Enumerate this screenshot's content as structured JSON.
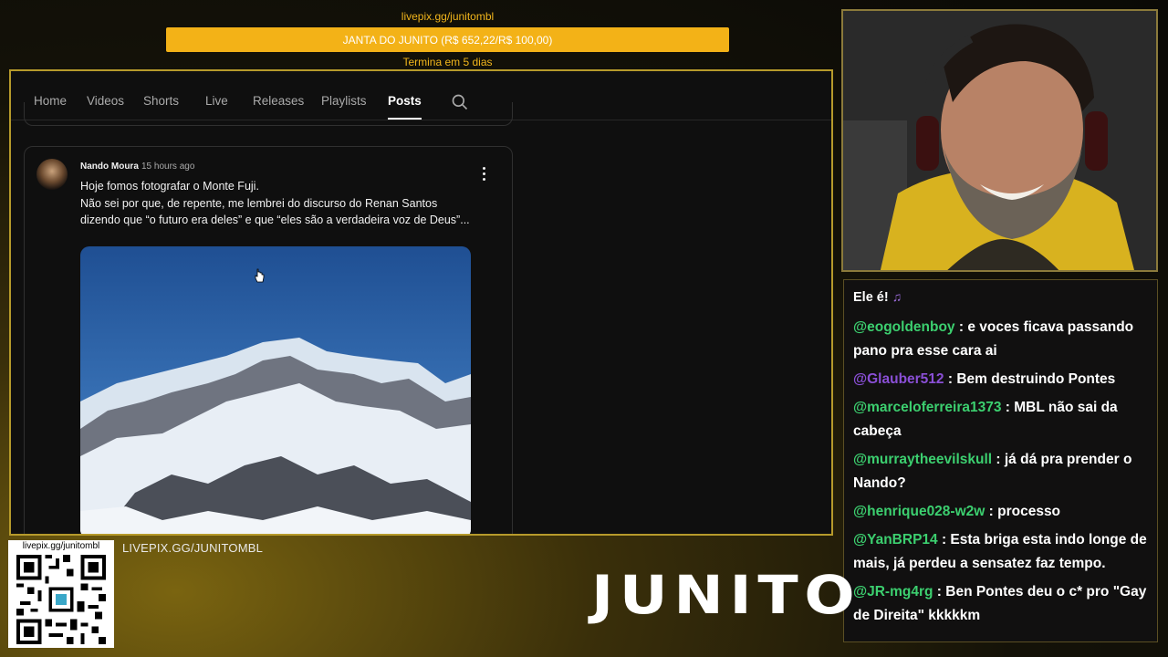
{
  "goal": {
    "url": "livepix.gg/junitombl",
    "label": "JANTA DO JUNITO (R$ 652,22/R$ 100,00)",
    "subtitle": "Termina em 5 dias",
    "color": "#f3b217"
  },
  "youtube": {
    "tabs": [
      "Home",
      "Videos",
      "Shorts",
      "Live",
      "Releases",
      "Playlists",
      "Posts"
    ],
    "active_tab": "Posts",
    "post": {
      "author": "Nando Moura",
      "time": "15 hours ago",
      "text": "Hoje fomos fotografar o Monte Fuji.\nNão sei por que, de repente, me lembrei do discurso do Renan Santos dizendo que “o futuro era deles” e que “eles são a verdadeira voz de Deus”..."
    }
  },
  "chat": {
    "header": "Ele é!",
    "header_icon": "music-note-icon",
    "messages": [
      {
        "user": "@eogoldenboy",
        "text": ": e voces ficava passando pano pra esse cara ai",
        "color": "#3ccf6f"
      },
      {
        "user": "@Glauber512",
        "text": ": Bem destruindo Pontes",
        "color": "#8a4fd6"
      },
      {
        "user": "@marceloferreira1373",
        "text": ": MBL não sai da cabeça",
        "color": "#3ccf6f"
      },
      {
        "user": "@murraytheevilskull",
        "text": ": já dá pra prender o Nando?",
        "color": "#3ccf6f"
      },
      {
        "user": "@henrique028-w2w",
        "text": ": processo",
        "color": "#3ccf6f"
      },
      {
        "user": "@YanBRP14",
        "text": ": Esta briga esta indo longe de mais, já perdeu a sensatez faz tempo.",
        "color": "#3ccf6f"
      },
      {
        "user": "@JR-mg4rg",
        "text": ": Ben Pontes deu o c* pro \"Gay de Direita\" kkkkkm",
        "color": "#3ccf6f"
      }
    ]
  },
  "qr": {
    "url": "livepix.gg/junitombl"
  },
  "caption": "LIVEPIX.GG/JUNITOMBL",
  "brand": "JUNITO"
}
